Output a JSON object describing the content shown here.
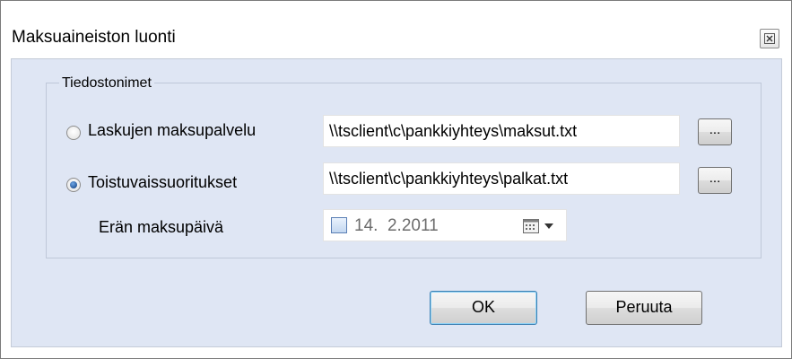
{
  "window": {
    "title": "Maksuaineiston luonti",
    "close_glyph": "⊠"
  },
  "group": {
    "legend": "Tiedostonimet",
    "rows": [
      {
        "label": "Laskujen maksupalvelu",
        "selected": false,
        "path": "\\\\tsclient\\c\\pankkiyhteys\\maksut.txt",
        "browse_label": "..."
      },
      {
        "label": "Toistuvaissuoritukset",
        "selected": true,
        "path": "\\\\tsclient\\c\\pankkiyhteys\\palkat.txt",
        "browse_label": "..."
      }
    ],
    "date": {
      "label": "Erän maksupäivä",
      "checked": false,
      "value": "14.  2.2011"
    }
  },
  "buttons": {
    "ok_label": "OK",
    "cancel_label": "Peruuta"
  }
}
